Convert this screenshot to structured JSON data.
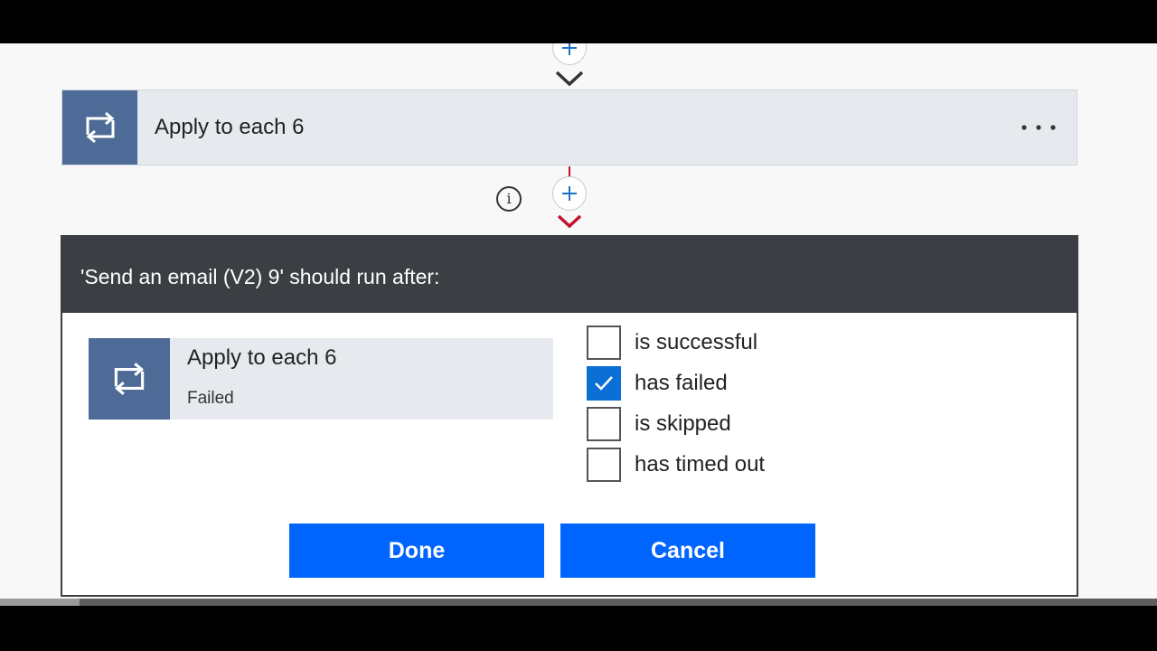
{
  "flow_step": {
    "title": "Apply to each 6",
    "icon": "loop-icon",
    "menu_icon": "ellipsis-icon"
  },
  "connector": {
    "add_icon": "plus-icon",
    "info_icon": "info-icon",
    "info_glyph": "i"
  },
  "dialog": {
    "title": "'Send an email (V2) 9' should run after:",
    "previous_action": {
      "name": "Apply to each 6",
      "status": "Failed",
      "icon": "loop-icon"
    },
    "options": [
      {
        "label": "is successful",
        "checked": false
      },
      {
        "label": "has failed",
        "checked": true
      },
      {
        "label": "is skipped",
        "checked": false
      },
      {
        "label": "has timed out",
        "checked": false
      }
    ],
    "done_label": "Done",
    "cancel_label": "Cancel"
  },
  "colors": {
    "accent": "#0065ff",
    "tile": "#4d6b96",
    "header": "#3b3f44",
    "error_connector": "#c0142b"
  }
}
